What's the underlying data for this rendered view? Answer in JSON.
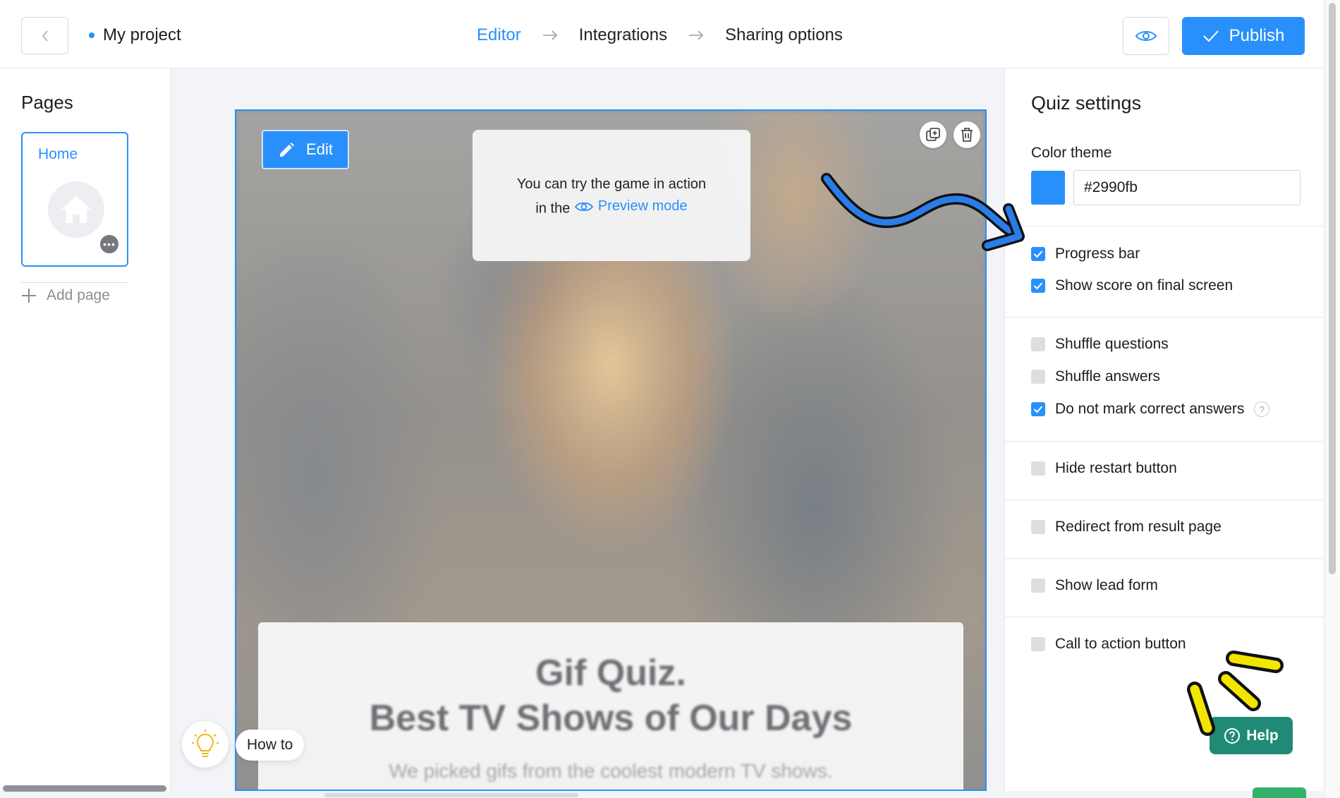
{
  "topbar": {
    "project_name": "My project",
    "steps": [
      "Editor",
      "Integrations",
      "Sharing options"
    ],
    "publish_label": "Publish"
  },
  "sidebar": {
    "title": "Pages",
    "pages": [
      {
        "label": "Home"
      }
    ],
    "add_page_label": "Add page"
  },
  "canvas": {
    "edit_label": "Edit",
    "tooltip_line1": "You can try the game in action",
    "tooltip_line2_prefix": "in the",
    "tooltip_link": "Preview mode",
    "quiz_title_line1": "Gif Quiz.",
    "quiz_title_line2": "Best TV Shows of Our Days",
    "quiz_subtitle": "We picked gifs from the coolest modern TV shows."
  },
  "howto": {
    "label": "How to"
  },
  "settings": {
    "title": "Quiz settings",
    "color_theme_label": "Color theme",
    "color_value": "#2990fb",
    "options": [
      {
        "label": "Progress bar",
        "checked": true
      },
      {
        "label": "Show score on final screen",
        "checked": true
      },
      {
        "label": "Shuffle questions",
        "checked": false
      },
      {
        "label": "Shuffle answers",
        "checked": false
      },
      {
        "label": "Do not mark correct answers",
        "checked": true,
        "help": "?"
      },
      {
        "label": "Hide restart button",
        "checked": false
      },
      {
        "label": "Redirect from result page",
        "checked": false
      },
      {
        "label": "Show lead form",
        "checked": false
      },
      {
        "label": "Call to action button",
        "checked": false
      }
    ]
  },
  "help": {
    "label": "Help"
  },
  "colors": {
    "accent": "#2990fb",
    "help_bg": "#1f8a76",
    "annotation_arrow": "#2a7de8",
    "annotation_marks": "#f2e600"
  }
}
